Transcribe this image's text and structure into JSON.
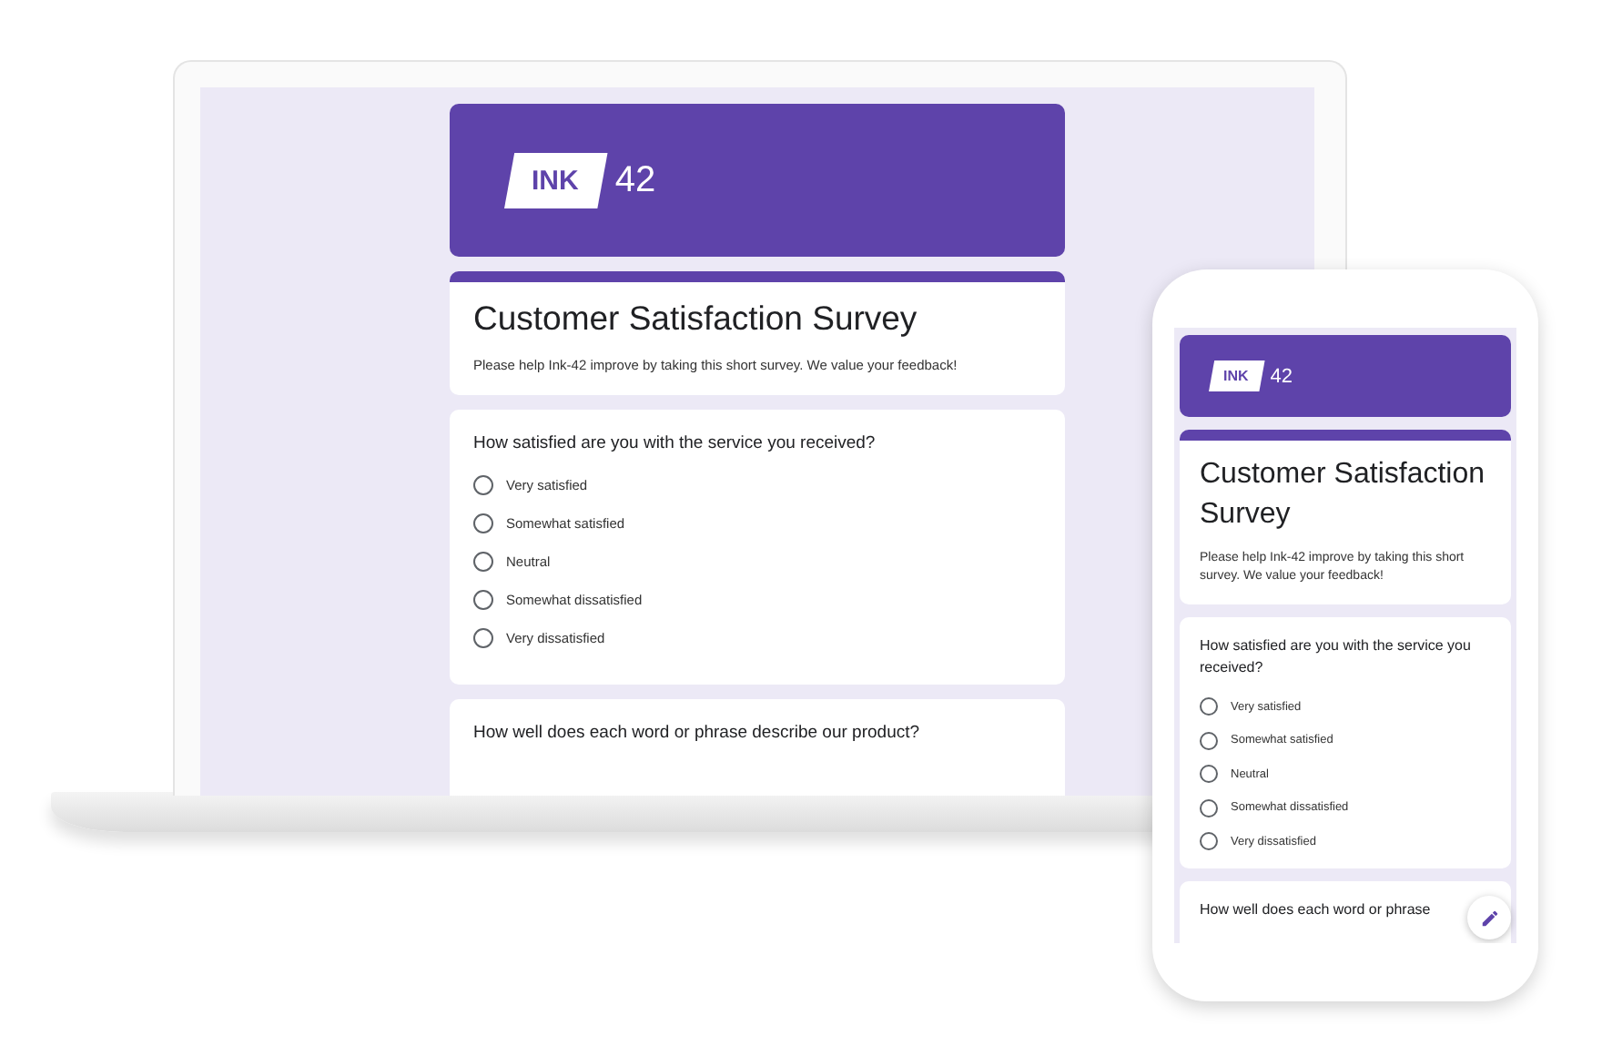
{
  "laptop": {
    "logo": {
      "mark": "INK",
      "text": "42"
    },
    "title": "Customer Satisfaction Survey",
    "description": "Please help Ink-42 improve by taking this short survey. We value your feedback!",
    "questions": [
      {
        "text": "How satisfied are you with the service you received?",
        "options": [
          {
            "label": "Very satisfied",
            "selected": false
          },
          {
            "label": "Somewhat satisfied",
            "selected": false
          },
          {
            "label": "Neutral",
            "selected": false
          },
          {
            "label": "Somewhat dissatisfied",
            "selected": false
          },
          {
            "label": "Very dissatisfied",
            "selected": false
          }
        ]
      },
      {
        "text": "How well does each word or phrase describe our product?"
      }
    ]
  },
  "phone": {
    "logo": {
      "mark": "INK",
      "text": "42"
    },
    "title": "Customer Satisfaction Survey",
    "description": "Please help Ink-42 improve by taking this short survey. We value your feedback!",
    "questions": [
      {
        "text": "How satisfied are you with the service you received?",
        "options": [
          {
            "label": "Very satisfied",
            "selected": false
          },
          {
            "label": "Somewhat satisfied",
            "selected": false
          },
          {
            "label": "Neutral",
            "selected": false
          },
          {
            "label": "Somewhat dissatisfied",
            "selected": false
          },
          {
            "label": "Very dissatisfied",
            "selected": false
          }
        ]
      },
      {
        "text": "How well does each word or phrase"
      }
    ]
  }
}
